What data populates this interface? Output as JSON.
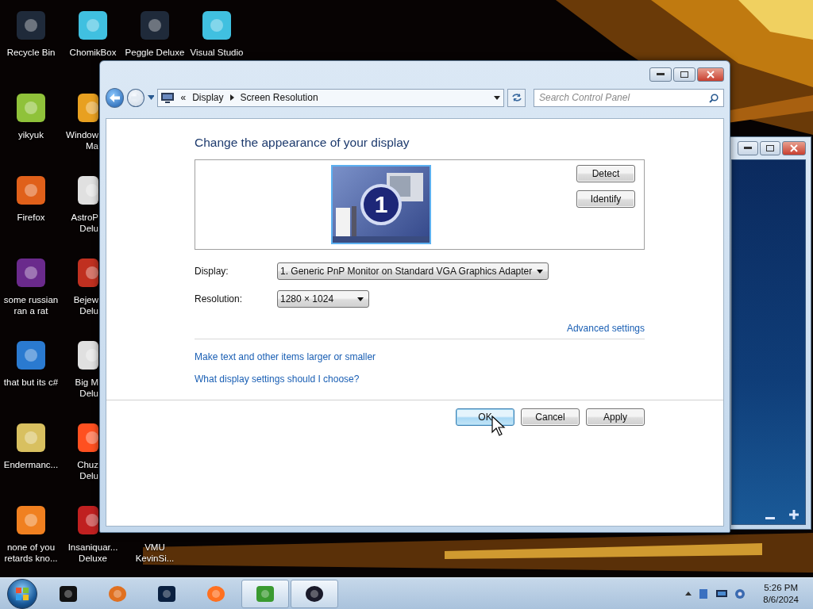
{
  "desktop": {
    "columns": [
      [
        {
          "label": "Recycle Bin"
        },
        {
          "label": "yikyuk"
        },
        {
          "label": "Firefox"
        },
        {
          "label": "some russian\nran a rat"
        },
        {
          "label": "that but its c#"
        },
        {
          "label": "Endermanc..."
        },
        {
          "label": "none of you\nretards kno..."
        }
      ],
      [
        {
          "label": "ChomikBox"
        },
        {
          "label": "Window\nMa"
        },
        {
          "label": "AstroP\nDelu"
        },
        {
          "label": "Bejew\nDelu"
        },
        {
          "label": "Big M\nDelu"
        },
        {
          "label": "Chuz\nDelu"
        },
        {
          "label": "Insaniquar...\nDeluxe"
        }
      ],
      [
        {
          "label": "Peggle Deluxe"
        },
        {
          "label": "VMU\nKevinSi..."
        }
      ],
      [
        {
          "label": "Visual Studio"
        }
      ]
    ]
  },
  "explorer": {
    "back": {
      "disabled": false
    },
    "forward": {
      "disabled": true
    },
    "path_mark": "«",
    "breadcrumb": [
      "Display",
      "Screen Resolution"
    ],
    "search": {
      "placeholder": "Search Control Panel"
    },
    "heading": "Change the appearance of your display",
    "monitor": {
      "number": "1",
      "selected": true
    },
    "side_buttons": [
      "Detect",
      "Identify"
    ],
    "fields": [
      {
        "label": "Display:",
        "value": "1. Generic PnP Monitor on Standard VGA Graphics Adapter"
      },
      {
        "label": "Resolution:",
        "value": "1280 × 1024"
      }
    ],
    "advanced_link": "Advanced settings",
    "links": [
      "Make text and other items larger or smaller",
      "What display settings should I choose?"
    ],
    "buttons": [
      {
        "label": "OK",
        "default": true
      },
      {
        "label": "Cancel",
        "default": false
      },
      {
        "label": "Apply",
        "default": false
      }
    ]
  },
  "taskbar": {
    "items": [
      {
        "open": false
      },
      {
        "open": false
      },
      {
        "open": false
      },
      {
        "open": false
      },
      {
        "open": true
      },
      {
        "open": true
      }
    ],
    "clock": {
      "time": "5:26 PM",
      "date": "8/6/2024"
    }
  }
}
